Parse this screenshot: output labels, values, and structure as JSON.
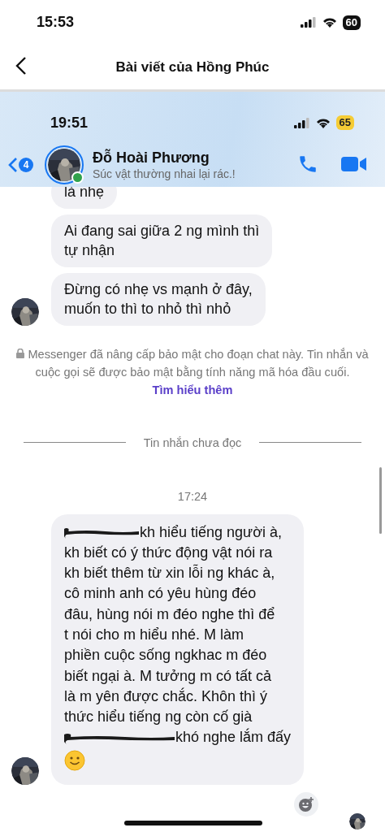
{
  "status_bar": {
    "time": "15:53",
    "battery": "60"
  },
  "header": {
    "title": "Bài viết của Hồng Phúc"
  },
  "post_screenshot": {
    "status_bar": {
      "time": "19:51",
      "battery": "65"
    },
    "chat_header": {
      "back_badge": "4",
      "name": "Đỗ Hoài Phương",
      "status": "Súc vật thường nhai lại rác.!",
      "online": true
    },
    "messages": [
      {
        "lines": [
          {
            "text": "là nhẹ"
          }
        ],
        "show_avatar": false
      },
      {
        "lines": [
          {
            "text": "Ai đang sai giữa 2 ng mình thì"
          },
          {
            "text": "tự nhận"
          }
        ],
        "show_avatar": false
      },
      {
        "lines": [
          {
            "text": "Đừng có nhẹ vs mạnh ở đây,"
          },
          {
            "text": "muốn to thì to nhỏ thì nhỏ"
          }
        ],
        "show_avatar": true
      }
    ],
    "security_notice": {
      "text": "Messenger đã nâng cấp bảo mật cho đoạn chat này. Tin nhắn và cuộc gọi sẽ được bảo mật bằng tính năng mã hóa đầu cuối.",
      "link": "Tìm hiểu thêm"
    },
    "unread_divider": "Tin nhắn chưa đọc",
    "timestamp": "17:24",
    "last_message": {
      "show_avatar": true,
      "lines": [
        {
          "redacted": true,
          "text": "kh hiểu tiếng người à,"
        },
        {
          "text": "kh biết có ý thức động vật nói ra"
        },
        {
          "text": "kh biết thêm từ xin lỗi ng khác à,"
        },
        {
          "text": "cô minh anh có yêu hùng đéo"
        },
        {
          "text": "đâu, hùng nói m đéo nghe thì để"
        },
        {
          "text": "t nói cho m hiểu nhé. M làm"
        },
        {
          "text": "phiền cuộc sống ngkhac m đéo"
        },
        {
          "text": "biết ngại à. M tưởng m có tất cả"
        },
        {
          "text": "là m yên được chắc. Khôn thì ý"
        },
        {
          "text": "thức hiểu tiếng ng còn cố già"
        },
        {
          "redacted": true,
          "text": "khó nghe lắm đấy"
        }
      ]
    }
  }
}
